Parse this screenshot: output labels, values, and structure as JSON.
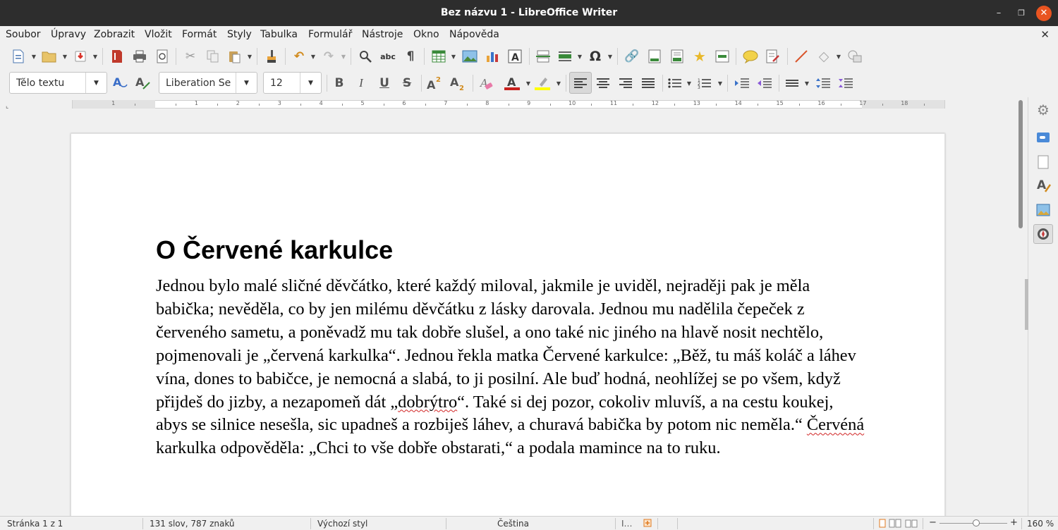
{
  "window": {
    "title": "Bez názvu 1 - LibreOffice Writer",
    "minimize_glyph": "–",
    "maximize_glyph": "❐",
    "close_glyph": "✕"
  },
  "menubar": {
    "items": [
      "Soubor",
      "Úpravy",
      "Zobrazit",
      "Vložit",
      "Formát",
      "Styly",
      "Tabulka",
      "Formulář",
      "Nástroje",
      "Okno",
      "Nápověda"
    ],
    "doc_close_glyph": "✕"
  },
  "format_toolbar": {
    "paragraph_style": "Tělo textu",
    "font_name": "Liberation Se",
    "font_size": "12"
  },
  "ruler": {
    "numbers": [
      "1",
      "1",
      "2",
      "3",
      "4",
      "5",
      "6",
      "7",
      "8",
      "9",
      "10",
      "11",
      "12",
      "13",
      "14",
      "15",
      "16",
      "17",
      "18"
    ]
  },
  "document": {
    "heading": "O Červené karkulce",
    "body_part1": "Jednou bylo malé sličné děvčátko, které každý miloval, jakmile je uviděl, nejraději pak je měla babička; nevěděla, co by jen milému děvčátku z lásky darovala. Jednou mu nadělila čepeček z červeného sametu, a poněvadž mu tak dobře slušel, a ono také nic jiného na hlavě nosit nechtělo, pojmenovali je „červená karkulka“. Jednou řekla matka Červené karkulce: „Běž, tu máš koláč a láhev vína, dones to babičce, je nemocná a slabá, to ji posilní. Ale buď hodná, neohlížej se po všem, když přijdeš do jizby, a nezapomeň dát „",
    "misspelled_1": "dobrýtro",
    "body_part2": "“. Také si dej pozor, cokoliv mluvíš, a na cestu koukej, abys se silnice nesešla, sic upadneš a rozbiješ láhev, a churavá babička by potom nic neměla.“ ",
    "misspelled_2": "Červéná",
    "body_part3": " karkulka odpověděla: „Chci to vše dobře obstarati,“ a podala mamince na to ruku."
  },
  "statusbar": {
    "page": "Stránka 1 z 1",
    "word_count": "131 slov, 787 znaků",
    "page_style": "Výchozí styl",
    "language": "Čeština",
    "zoom_minus": "−",
    "zoom_plus": "+",
    "zoom_level": "160 %"
  },
  "colors": {
    "titlebar": "#2d2d2d",
    "close_button": "#e95420",
    "font_color": "#c9211e",
    "highlight_color": "#ffff00",
    "spellcheck": "#d02020"
  },
  "icons": {
    "new": "new-document-icon",
    "open": "open-folder-icon",
    "save": "save-icon",
    "pdf": "export-pdf-icon",
    "print": "print-icon",
    "preview": "print-preview-icon",
    "cut": "cut-icon",
    "copy": "copy-icon",
    "paste": "paste-icon",
    "clone": "clone-formatting-icon",
    "undo": "undo-icon",
    "redo": "redo-icon",
    "find": "find-replace-icon",
    "spelling": "spelling-icon",
    "formatting_marks": "formatting-marks-icon",
    "table": "insert-table-icon",
    "image": "insert-image-icon",
    "chart": "insert-chart-icon",
    "textbox": "insert-textbox-icon",
    "page_break": "page-break-icon",
    "field": "insert-field-icon",
    "special_char": "special-character-icon",
    "hyperlink": "hyperlink-icon",
    "footnote": "footnote-icon",
    "endnote": "endnote-icon",
    "bookmark": "bookmark-icon",
    "cross_reference": "cross-reference-icon",
    "comment": "comment-icon",
    "track_changes": "track-changes-icon",
    "line": "line-icon",
    "shapes": "basic-shapes-icon",
    "draw": "draw-functions-icon"
  }
}
